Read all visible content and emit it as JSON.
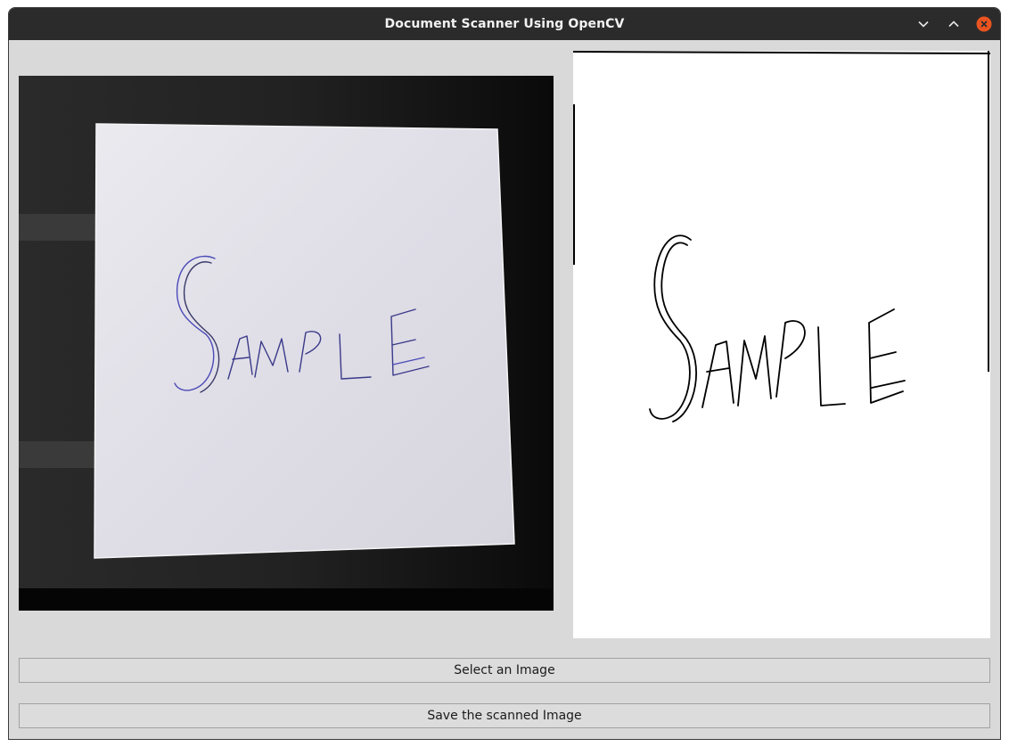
{
  "window": {
    "title": "Document Scanner Using OpenCV",
    "controls": [
      "chevron-down-icon",
      "chevron-up-icon",
      "close-icon"
    ]
  },
  "images": {
    "original": {
      "handwritten_text": "SAMPLE",
      "ink_color": "#3a3aa8"
    },
    "scanned": {
      "handwritten_text": "SAMPLE",
      "ink_color": "#000000"
    }
  },
  "buttons": {
    "select_label": "Select an Image",
    "save_label": "Save the scanned Image"
  },
  "colors": {
    "titlebar": "#2b2b2b",
    "window_bg": "#d9d9d9",
    "close_accent": "#e95420"
  }
}
